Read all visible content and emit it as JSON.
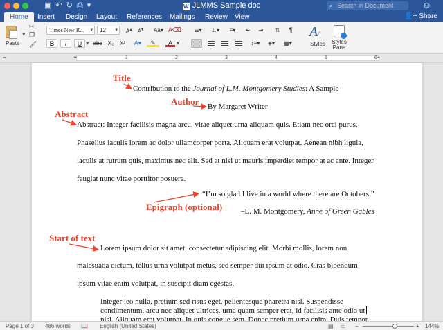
{
  "window": {
    "title": "JLMMS Sample doc",
    "search_placeholder": "Search in Document"
  },
  "tabs": [
    {
      "label": "Home"
    },
    {
      "label": "Insert"
    },
    {
      "label": "Design"
    },
    {
      "label": "Layout"
    },
    {
      "label": "References"
    },
    {
      "label": "Mailings"
    },
    {
      "label": "Review"
    },
    {
      "label": "View"
    }
  ],
  "share_label": "Share",
  "ribbon": {
    "paste_label": "Paste",
    "font_name": "Times New R...",
    "font_size": "12",
    "styles_label": "Styles",
    "styles_pane_label_1": "Styles",
    "styles_pane_label_2": "Pane"
  },
  "ruler_numbers": [
    "1",
    "2",
    "3",
    "4",
    "5",
    "6"
  ],
  "document": {
    "title_line_prefix": "Contribution to the ",
    "title_line_journal": "Journal of L.M. Montgomery Studies",
    "title_line_suffix": ": A Sample",
    "author_line": "By Margaret Writer",
    "abstract_lines": [
      "Abstract: Integer facilisis magna arcu, vitae aliquet urna aliquam quis. Etiam nec orci purus.",
      "Phasellus iaculis lorem ac dolor ullamcorper porta. Aliquam erat volutpat. Aenean nibh ligula,",
      "iaculis at rutrum quis, maximus nec elit. Sed at nisi ut mauris imperdiet tempor at ac ante. Integer",
      "feugiat nunc vitae porttitor posuere."
    ],
    "epigraph_quote": "“I’m so glad I live in a world where there are Octobers.”",
    "epigraph_attr_prefix": "–L. M. Montgomery, ",
    "epigraph_attr_title": "Anne of Green Gables",
    "body_lines": [
      "Lorem ipsum dolor sit amet, consectetur adipiscing elit. Morbi mollis, lorem non",
      "malesuada dictum, tellus urna volutpat metus, sed semper dui ipsum at odio. Cras bibendum",
      "ipsum vitae enim volutpat, in suscipit diam egestas."
    ],
    "block_lines": [
      "Integer leo nulla, pretium sed risus eget, pellentesque pharetra nisl. Suspendisse",
      "condimentum, arcu nec aliquet ultrices, urna quam semper erat, id facilisis ante odio ut",
      "nisl. Aliquam erat volutpat. In quis congue sem. Donec pretium urna enim. Duis tempor"
    ]
  },
  "annotations": {
    "title": "Title",
    "author": "Author",
    "abstract": "Abstract",
    "epigraph": "Epigraph (optional)",
    "start": "Start of text",
    "color": "#e8452c"
  },
  "status": {
    "page": "Page 1 of 3",
    "words": "486 words",
    "language": "English (United States)",
    "zoom": "144%"
  }
}
